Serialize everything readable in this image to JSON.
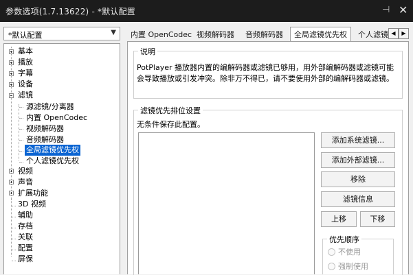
{
  "window": {
    "title": "参数选项(1.7.13622) - *默认配置"
  },
  "preset": {
    "value": "*默认配置"
  },
  "tree": {
    "items": [
      {
        "label": "基本"
      },
      {
        "label": "播放"
      },
      {
        "label": "字幕"
      },
      {
        "label": "设备"
      },
      {
        "label": "滤镜"
      },
      {
        "label": "源滤镜/分离器"
      },
      {
        "label": "内置 OpenCodec"
      },
      {
        "label": "视频解码器"
      },
      {
        "label": "音频解码器"
      },
      {
        "label": "全局滤镜优先权"
      },
      {
        "label": "个人滤镜优先权"
      },
      {
        "label": "视频"
      },
      {
        "label": "声音"
      },
      {
        "label": "扩展功能"
      },
      {
        "label": "3D 视频"
      },
      {
        "label": "辅助"
      },
      {
        "label": "存档"
      },
      {
        "label": "关联"
      },
      {
        "label": "配置"
      },
      {
        "label": "屏保"
      }
    ]
  },
  "tabs": [
    {
      "label": "内置 OpenCodec"
    },
    {
      "label": "视频解码器"
    },
    {
      "label": "音频解码器"
    },
    {
      "label": "全局滤镜优先权"
    },
    {
      "label": "个人滤镜"
    }
  ],
  "description": {
    "legend": "说明",
    "text": "PotPlayer 播放器内置的编解码器或滤镜已够用，用外部编解码器或滤镜可能会导致播放或引发冲突。除非万不得已，请不要使用外部的编解码器或滤镜。"
  },
  "priority": {
    "legend": "滤镜优先排位设置",
    "note": "无条件保存此配置。"
  },
  "buttons": {
    "add_system": "添加系统滤镜...",
    "add_external": "添加外部滤镜...",
    "remove": "移除",
    "info": "滤镜信息",
    "up": "上移",
    "down": "下移"
  },
  "order": {
    "legend": "优先顺序",
    "options": [
      {
        "label": "不使用"
      },
      {
        "label": "强制使用"
      }
    ]
  },
  "icons": {
    "pin": "pin-icon",
    "close": "close-icon",
    "tab_prev": "chevron-left-icon",
    "tab_next": "chevron-right-icon",
    "dropdown": "chevron-down-icon"
  },
  "colors": {
    "titlebar": "#1c1c1c",
    "selection": "#0a64d2"
  }
}
